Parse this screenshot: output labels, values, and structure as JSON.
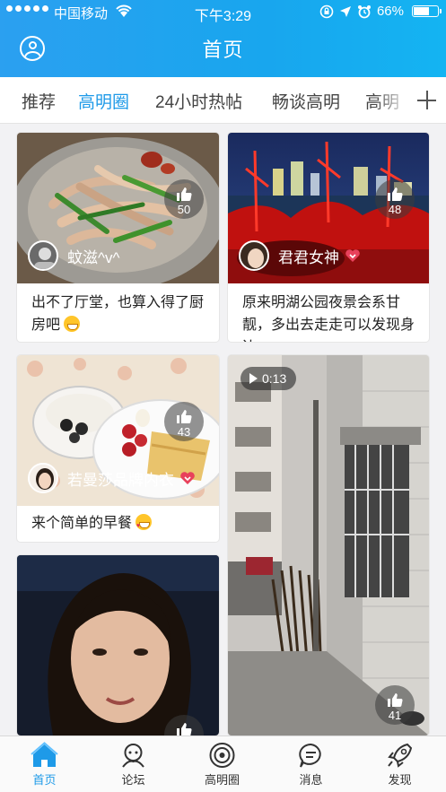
{
  "status_bar": {
    "carrier": "中国移动",
    "time": "下午3:29",
    "battery": "66%",
    "battery_level": 0.66
  },
  "header": {
    "title": "首页"
  },
  "tabs": [
    {
      "label": "推荐",
      "active": false
    },
    {
      "label": "高明圈",
      "active": true
    },
    {
      "label": "24小时热帖",
      "active": false
    },
    {
      "label": "畅谈高明",
      "active": false
    },
    {
      "label": "高明",
      "active": false
    }
  ],
  "posts": [
    {
      "author": "蚊滋^v^",
      "likes": "50",
      "caption": "出不了厅堂，也算入得了厨房吧",
      "emoji": "grin-emoji"
    },
    {
      "author": "君君女神",
      "likes": "48",
      "caption": "原来明湖公园夜景会系甘靓，多出去走走可以发现身边",
      "verified": true
    },
    {
      "author": "若曼莎品牌内衣",
      "likes": "43",
      "caption": "来个简单的早餐",
      "emoji": "heart-eyes-emoji",
      "verified": true
    },
    {
      "author": "",
      "likes": "41",
      "video_duration": "0:13"
    },
    {
      "author": "",
      "likes": ""
    }
  ],
  "bottom_nav": [
    {
      "label": "首页",
      "icon": "home-icon",
      "active": true
    },
    {
      "label": "论坛",
      "icon": "forum-icon",
      "active": false
    },
    {
      "label": "高明圈",
      "icon": "circle-icon",
      "active": false
    },
    {
      "label": "消息",
      "icon": "message-icon",
      "active": false
    },
    {
      "label": "发现",
      "icon": "discover-icon",
      "active": false
    }
  ],
  "colors": {
    "accent": "#1e9ae8",
    "header_start": "#2ba0f0",
    "header_end": "#14b4f2"
  }
}
